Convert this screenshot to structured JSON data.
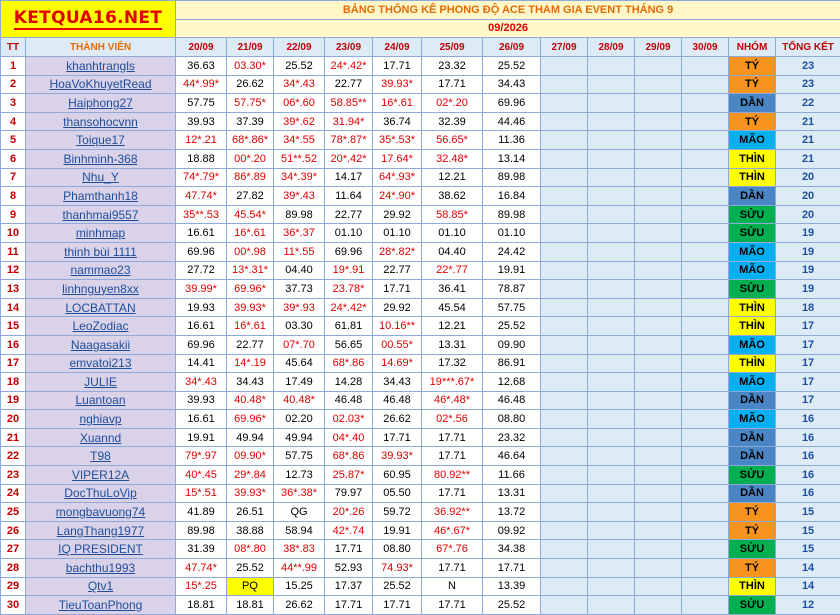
{
  "logo": "KETQUA16.NET",
  "title": "BẢNG THỐNG KÊ PHONG ĐỘ ACE THAM GIA EVENT THÁNG 9",
  "month": "09/2026",
  "headers": {
    "tt": "TT",
    "member": "THÀNH VIÊN",
    "dates": [
      "20/09",
      "21/09",
      "22/09",
      "23/09",
      "24/09",
      "25/09",
      "26/09",
      "27/09",
      "28/09",
      "29/09",
      "30/09"
    ],
    "group": "NHÓM",
    "total": "TỔNG KẾT"
  },
  "colors": {
    "ty": "#f7941d",
    "dan": "#4a86c5",
    "mao": "#00b0f0",
    "thin": "#ffff00",
    "suu": "#00b050",
    "red_value": "#e00000",
    "name_bg": "#d9d2e9"
  },
  "rows": [
    {
      "tt": "1",
      "name": "khanhtrangls",
      "vals": [
        "36.63",
        "03.30*",
        "25.52",
        "24*.42*",
        "17.71",
        "23.32",
        "25.52"
      ],
      "red": [
        false,
        true,
        false,
        true,
        false,
        false,
        false
      ],
      "group": "TÝ",
      "group_key": "ty",
      "score": "23"
    },
    {
      "tt": "2",
      "name": "HoaVoKhuyetRead",
      "vals": [
        "44*.99*",
        "26.62",
        "34*.43",
        "22.77",
        "39.93*",
        "17.71",
        "34.43"
      ],
      "red": [
        true,
        false,
        true,
        false,
        true,
        false,
        false
      ],
      "group": "TÝ",
      "group_key": "ty",
      "score": "23"
    },
    {
      "tt": "3",
      "name": "Haiphong27",
      "vals": [
        "57.75",
        "57.75*",
        "06*.60",
        "58.85**",
        "16*.61",
        "02*.20",
        "69.96"
      ],
      "red": [
        false,
        true,
        true,
        true,
        true,
        true,
        false
      ],
      "group": "DẦN",
      "group_key": "dan",
      "score": "22"
    },
    {
      "tt": "4",
      "name": "thansohocvnn",
      "vals": [
        "39.93",
        "37.39",
        "39*.62",
        "31.94*",
        "36.74",
        "32.39",
        "44.46"
      ],
      "red": [
        false,
        false,
        true,
        true,
        false,
        false,
        false
      ],
      "group": "TÝ",
      "group_key": "ty",
      "score": "21"
    },
    {
      "tt": "5",
      "name": "Toique17",
      "vals": [
        "12*.21",
        "68*.86*",
        "34*.55",
        "78*.87*",
        "35*.53*",
        "56.65*",
        "11.36"
      ],
      "red": [
        true,
        true,
        true,
        true,
        true,
        true,
        false
      ],
      "group": "MÃO",
      "group_key": "mao",
      "score": "21"
    },
    {
      "tt": "6",
      "name": "Binhminh-368",
      "vals": [
        "18.88",
        "00*.20",
        "51**.52",
        "20*.42*",
        "17.64*",
        "32.48*",
        "13.14"
      ],
      "red": [
        false,
        true,
        true,
        true,
        true,
        true,
        false
      ],
      "group": "THÌN",
      "group_key": "thin",
      "score": "21"
    },
    {
      "tt": "7",
      "name": "Nhu_Y",
      "vals": [
        "74*.79*",
        "86*.89",
        "34*.39*",
        "14.17",
        "64*.93*",
        "12.21",
        "89.98"
      ],
      "red": [
        true,
        true,
        true,
        false,
        true,
        false,
        false
      ],
      "group": "THÌN",
      "group_key": "thin",
      "score": "20"
    },
    {
      "tt": "8",
      "name": "Phamthanh18",
      "vals": [
        "47.74*",
        "27.82",
        "39*.43",
        "11.64",
        "24*.90*",
        "38.62",
        "16.84"
      ],
      "red": [
        true,
        false,
        true,
        false,
        true,
        false,
        false
      ],
      "group": "DẦN",
      "group_key": "dan",
      "score": "20"
    },
    {
      "tt": "9",
      "name": "thanhmai9557",
      "vals": [
        "35**.53",
        "45.54*",
        "89.98",
        "22.77",
        "29.92",
        "58.85*",
        "89.98"
      ],
      "red": [
        true,
        true,
        false,
        false,
        false,
        true,
        false
      ],
      "group": "SỬU",
      "group_key": "suu",
      "score": "20"
    },
    {
      "tt": "10",
      "name": "minhmap",
      "vals": [
        "16.61",
        "16*.61",
        "36*.37",
        "01.10",
        "01.10",
        "01.10",
        "01.10"
      ],
      "red": [
        false,
        true,
        true,
        false,
        false,
        false,
        false
      ],
      "group": "SỬU",
      "group_key": "suu",
      "score": "19"
    },
    {
      "tt": "11",
      "name": "thinh bùi 1111",
      "vals": [
        "69.96",
        "00*.98",
        "11*.55",
        "69.96",
        "28*.82*",
        "04.40",
        "24.42"
      ],
      "red": [
        false,
        true,
        true,
        false,
        true,
        false,
        false
      ],
      "group": "MÃO",
      "group_key": "mao",
      "score": "19"
    },
    {
      "tt": "12",
      "name": "nammao23",
      "vals": [
        "27.72",
        "13*.31*",
        "04.40",
        "19*.91",
        "22.77",
        "22*.77",
        "19.91"
      ],
      "red": [
        false,
        true,
        false,
        true,
        false,
        true,
        false
      ],
      "group": "MÃO",
      "group_key": "mao",
      "score": "19"
    },
    {
      "tt": "13",
      "name": "linhnguyen8xx",
      "vals": [
        "39.99*",
        "69.96*",
        "37.73",
        "23.78*",
        "17.71",
        "36.41",
        "78.87"
      ],
      "red": [
        true,
        true,
        false,
        true,
        false,
        false,
        false
      ],
      "group": "SỬU",
      "group_key": "suu",
      "score": "19"
    },
    {
      "tt": "14",
      "name": "LOCBATTAN",
      "vals": [
        "19.93",
        "39.93*",
        "39*.93",
        "24*.42*",
        "29.92",
        "45.54",
        "57.75"
      ],
      "red": [
        false,
        true,
        true,
        true,
        false,
        false,
        false
      ],
      "group": "THÌN",
      "group_key": "thin",
      "score": "18"
    },
    {
      "tt": "15",
      "name": "LeoZodiac",
      "vals": [
        "16.61",
        "16*.61",
        "03.30",
        "61.81",
        "10.16**",
        "12.21",
        "25.52"
      ],
      "red": [
        false,
        true,
        false,
        false,
        true,
        false,
        false
      ],
      "group": "THÌN",
      "group_key": "thin",
      "score": "17"
    },
    {
      "tt": "16",
      "name": "Naagasakii",
      "vals": [
        "69.96",
        "22.77",
        "07*.70",
        "56.65",
        "00.55*",
        "13.31",
        "09.90"
      ],
      "red": [
        false,
        false,
        true,
        false,
        true,
        false,
        false
      ],
      "group": "MÃO",
      "group_key": "mao",
      "score": "17"
    },
    {
      "tt": "17",
      "name": "emvatoi213",
      "vals": [
        "14.41",
        "14*.19",
        "45.64",
        "68*.86",
        "14.69*",
        "17.32",
        "86.91"
      ],
      "red": [
        false,
        true,
        false,
        true,
        true,
        false,
        false
      ],
      "group": "THÌN",
      "group_key": "thin",
      "score": "17"
    },
    {
      "tt": "18",
      "name": "JULIE",
      "vals": [
        "34*.43",
        "34.43",
        "17.49",
        "14.28",
        "34.43",
        "19***.67*",
        "12.68"
      ],
      "red": [
        true,
        false,
        false,
        false,
        false,
        true,
        false
      ],
      "group": "MÃO",
      "group_key": "mao",
      "score": "17"
    },
    {
      "tt": "19",
      "name": "Luantoan",
      "vals": [
        "39.93",
        "40.48*",
        "40.48*",
        "46.48",
        "46.48",
        "46*.48*",
        "46.48"
      ],
      "red": [
        false,
        true,
        true,
        false,
        false,
        true,
        false
      ],
      "group": "DẦN",
      "group_key": "dan",
      "score": "17"
    },
    {
      "tt": "20",
      "name": "nghiavp",
      "vals": [
        "16.61",
        "69.96*",
        "02.20",
        "02.03*",
        "26.62",
        "02*.56",
        "08.80"
      ],
      "red": [
        false,
        true,
        false,
        true,
        false,
        true,
        false
      ],
      "group": "MÃO",
      "group_key": "mao",
      "score": "16"
    },
    {
      "tt": "21",
      "name": "Xuannd",
      "vals": [
        "19.91",
        "49.94",
        "49.94",
        "04*.40",
        "17.71",
        "17.71",
        "23.32"
      ],
      "red": [
        false,
        false,
        false,
        true,
        false,
        false,
        false
      ],
      "group": "DẦN",
      "group_key": "dan",
      "score": "16"
    },
    {
      "tt": "22",
      "name": "T98",
      "vals": [
        "79*.97",
        "09.90*",
        "57.75",
        "68*.86",
        "39.93*",
        "17.71",
        "46.64"
      ],
      "red": [
        true,
        true,
        false,
        true,
        true,
        false,
        false
      ],
      "group": "DẦN",
      "group_key": "dan",
      "score": "16"
    },
    {
      "tt": "23",
      "name": "VIPER12A",
      "vals": [
        "40*.45",
        "29*.84",
        "12.73",
        "25.87*",
        "60.95",
        "80.92**",
        "11.66"
      ],
      "red": [
        true,
        true,
        false,
        true,
        false,
        true,
        false
      ],
      "group": "SỬU",
      "group_key": "suu",
      "score": "16"
    },
    {
      "tt": "24",
      "name": "DocThuLoVip",
      "vals": [
        "15*.51",
        "39.93*",
        "36*.38*",
        "79.97",
        "05.50",
        "17.71",
        "13.31"
      ],
      "red": [
        true,
        true,
        true,
        false,
        false,
        false,
        false
      ],
      "group": "DẦN",
      "group_key": "dan",
      "score": "16"
    },
    {
      "tt": "25",
      "name": "mongbavuong74",
      "vals": [
        "41.89",
        "26.51",
        "QG",
        "20*.26",
        "59.72",
        "36.92**",
        "13.72"
      ],
      "red": [
        false,
        false,
        false,
        true,
        false,
        true,
        false
      ],
      "group": "TÝ",
      "group_key": "ty",
      "score": "15"
    },
    {
      "tt": "26",
      "name": "LangThang1977",
      "vals": [
        "89.98",
        "38.88",
        "58.94",
        "42*.74",
        "19.91",
        "46*.67*",
        "09.92"
      ],
      "red": [
        false,
        false,
        false,
        true,
        false,
        true,
        false
      ],
      "group": "TÝ",
      "group_key": "ty",
      "score": "15"
    },
    {
      "tt": "27",
      "name": "IQ PRESIDENT",
      "vals": [
        "31.39",
        "08*.80",
        "38*.83",
        "17.71",
        "08.80",
        "67*.76",
        "34.38"
      ],
      "red": [
        false,
        true,
        true,
        false,
        false,
        true,
        false
      ],
      "group": "SỬU",
      "group_key": "suu",
      "score": "15"
    },
    {
      "tt": "28",
      "name": "bachthu1993",
      "vals": [
        "47.74*",
        "25.52",
        "44**.99",
        "52.93",
        "74.93*",
        "17.71",
        "17.71"
      ],
      "red": [
        true,
        false,
        true,
        false,
        true,
        false,
        false
      ],
      "group": "TÝ",
      "group_key": "ty",
      "score": "14"
    },
    {
      "tt": "29",
      "name": "Qtv1",
      "vals": [
        "15*.25",
        "PQ",
        "15.25",
        "17.37",
        "25.52",
        "N",
        "13.39"
      ],
      "red": [
        true,
        false,
        false,
        false,
        false,
        false,
        false
      ],
      "group": "THÌN",
      "group_key": "thin",
      "score": "14"
    },
    {
      "tt": "30",
      "name": "TieuToanPhong",
      "vals": [
        "18.81",
        "18.81",
        "26.62",
        "17.71",
        "17.71",
        "17.71",
        "25.52"
      ],
      "red": [
        false,
        false,
        false,
        false,
        false,
        false,
        false
      ],
      "group": "SỬU",
      "group_key": "suu",
      "score": "12"
    }
  ]
}
